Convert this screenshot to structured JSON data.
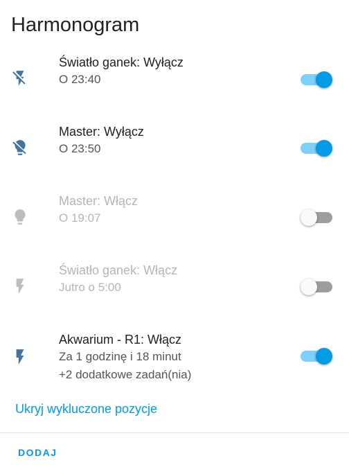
{
  "card": {
    "title": "Harmonogram"
  },
  "items": [
    {
      "name": "Światło ganek: Wyłącz",
      "time": "O 23:40",
      "extra": "",
      "icon": "flash-off-icon",
      "enabled": true
    },
    {
      "name": "Master: Wyłącz",
      "time": "O 23:50",
      "extra": "",
      "icon": "lightbulb-off-icon",
      "enabled": true
    },
    {
      "name": "Master: Włącz",
      "time": "O 19:07",
      "extra": "",
      "icon": "lightbulb-icon",
      "enabled": false
    },
    {
      "name": "Światło ganek: Włącz",
      "time": "Jutro o 5:00",
      "extra": "",
      "icon": "flash-icon",
      "enabled": false
    },
    {
      "name": "Akwarium - R1: Włącz",
      "time": "Za 1 godzinę i 18 minut",
      "extra": "+2 dodatkowe zadań(nia)",
      "icon": "flash-icon",
      "enabled": true
    }
  ],
  "footer": {
    "hide_link": "Ukryj wykluczone pozycje",
    "add_button": "DODAJ"
  },
  "colors": {
    "accent": "#039be5",
    "toggle_track_on": "#7fd0f8",
    "icon_active": "#44739e",
    "icon_disabled": "#bdbdbd",
    "text_primary": "#212121",
    "text_secondary": "#555555",
    "text_disabled": "#b5b5b5"
  }
}
